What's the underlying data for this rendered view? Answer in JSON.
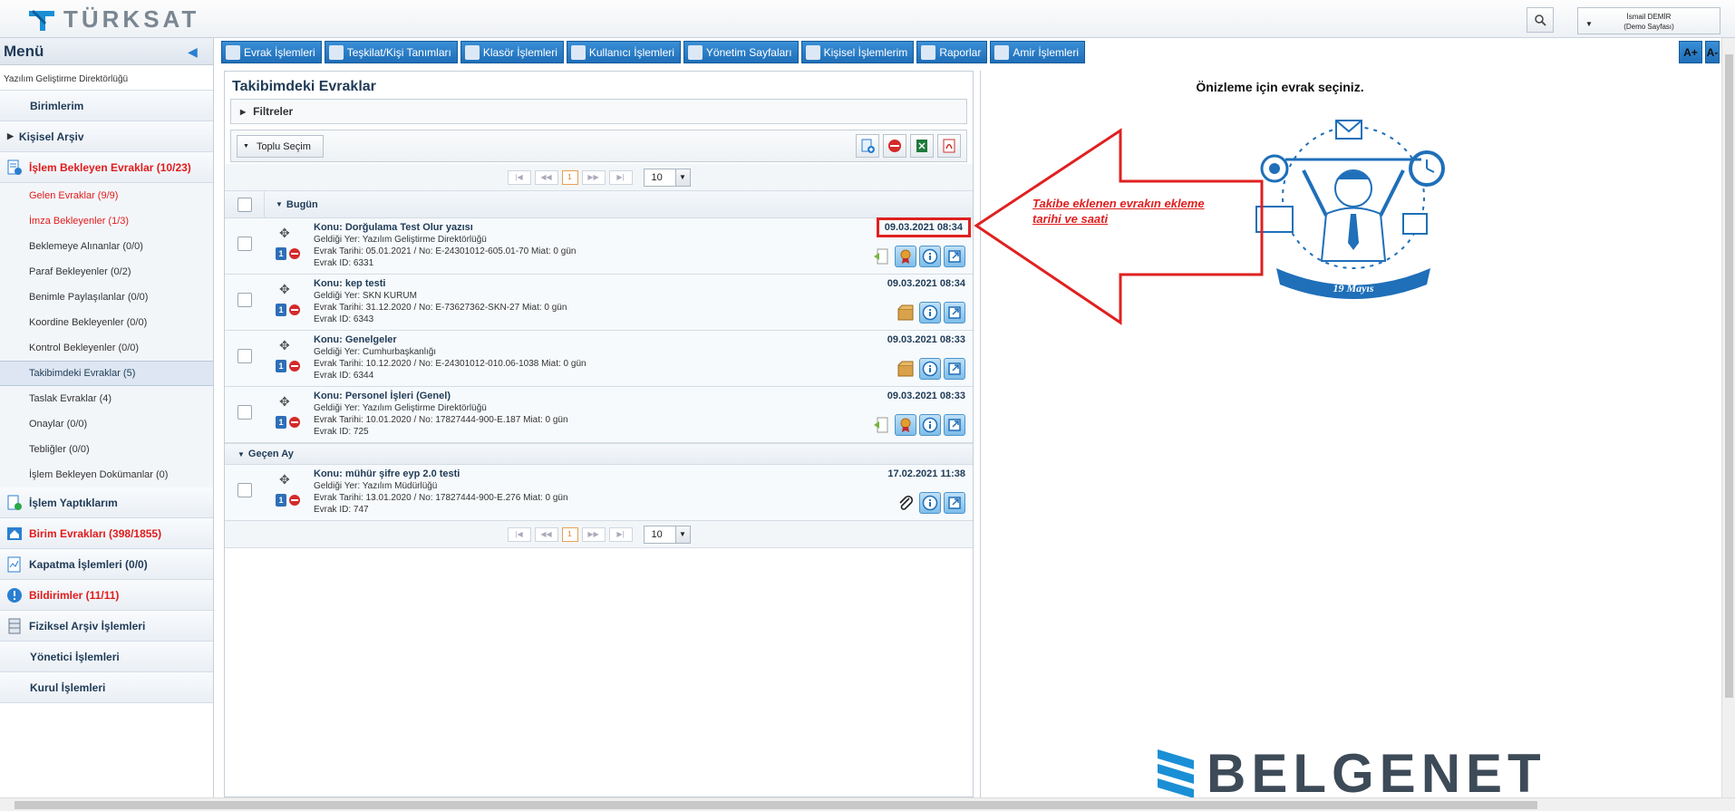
{
  "header": {
    "logo_text": "TÜRKSAT",
    "user_name": "İsmail DEMİR",
    "user_role": "(Demo Sayfası)"
  },
  "menu": {
    "title": "Menü",
    "org": "Yazılım Geliştirme Direktörlüğü",
    "birimlerim": "Birimlerim",
    "kisisel_arsiv": "Kişisel Arşiv",
    "islem_bekleyen": "İşlem Bekleyen Evraklar (10/23)",
    "sub_items": [
      "Gelen Evraklar (9/9)",
      "İmza Bekleyenler (1/3)",
      "Beklemeye Alınanlar (0/0)",
      "Paraf Bekleyenler (0/2)",
      "Benimle Paylaşılanlar (0/0)",
      "Koordine Bekleyenler (0/0)",
      "Kontrol Bekleyenler (0/0)",
      "Takibimdeki Evraklar (5)",
      "Taslak Evraklar (4)",
      "Onaylar (0/0)",
      "Tebliğler (0/0)",
      "İşlem Bekleyen Dokümanlar (0)"
    ],
    "islem_yaptiklarim": "İşlem Yaptıklarım",
    "birim_evraklari": "Birim Evrakları (398/1855)",
    "kapatma": "Kapatma İşlemleri (0/0)",
    "bildirimler": "Bildirimler (11/11)",
    "fiziksel_arsiv": "Fiziksel Arşiv İşlemleri",
    "yonetici": "Yönetici İşlemleri",
    "kurul": "Kurul İşlemleri"
  },
  "toolbar": {
    "items": [
      "Evrak İşlemleri",
      "Teşkilat/Kişi Tanımları",
      "Klasör İşlemleri",
      "Kullanıcı İşlemleri",
      "Yönetim Sayfaları",
      "Kişisel İşlemlerim",
      "Raporlar",
      "Amir İşlemleri"
    ],
    "font_plus": "A+",
    "font_minus": "A-"
  },
  "list": {
    "title": "Takibimdeki Evraklar",
    "filters": "Filtreler",
    "bulk_select": "Toplu Seçim",
    "page": "1",
    "page_size": "10",
    "group_today": "Bugün",
    "group_last_month": "Geçen Ay",
    "rows": [
      {
        "subject": "Konu: Dorğulama Test Olur yazısı",
        "from": "Geldiği Yer: Yazılım Geliştirme Direktörlüğü",
        "details": "Evrak Tarihi: 05.01.2021 / No: E-24301012-605.01-70 Miat: 0 gün",
        "id": "Evrak ID: 6331",
        "date": "09.03.2021 08:34"
      },
      {
        "subject": "Konu: kep testi",
        "from": "Geldiği Yer: SKN KURUM",
        "details": "Evrak Tarihi: 31.12.2020 / No: E-73627362-SKN-27 Miat: 0 gün",
        "id": "Evrak ID: 6343",
        "date": "09.03.2021 08:34"
      },
      {
        "subject": "Konu: Genelgeler",
        "from": "Geldiği Yer: Cumhurbaşkanlığı",
        "details": "Evrak Tarihi: 10.12.2020 / No: E-24301012-010.06-1038 Miat: 0 gün",
        "id": "Evrak ID: 6344",
        "date": "09.03.2021 08:33"
      },
      {
        "subject": "Konu: Personel İşleri (Genel)",
        "from": "Geldiği Yer: Yazılım Geliştirme Direktörlüğü",
        "details": "Evrak Tarihi: 10.01.2020 / No: 17827444-900-E.187 Miat: 0 gün",
        "id": "Evrak ID: 725",
        "date": "09.03.2021 08:33"
      },
      {
        "subject": "Konu: mühür şifre eyp 2.0 testi",
        "from": "Geldiği Yer: Yazılım Müdürlüğü",
        "details": "Evrak Tarihi: 13.01.2020 / No: 17827444-900-E.276 Miat: 0 gün",
        "id": "Evrak ID: 747",
        "date": "17.02.2021 11:38"
      }
    ]
  },
  "preview": {
    "title": "Önizleme için evrak seçiniz.",
    "ribbon_text": "19 Mayıs",
    "annotation": "Takibe eklenen evrakın ekleme tarihi ve saati",
    "brand": "BELGENET"
  },
  "colors": {
    "accent_blue": "#1f6fb9",
    "alert_red": "#e21b1b",
    "highlight_red": "#e02020"
  }
}
